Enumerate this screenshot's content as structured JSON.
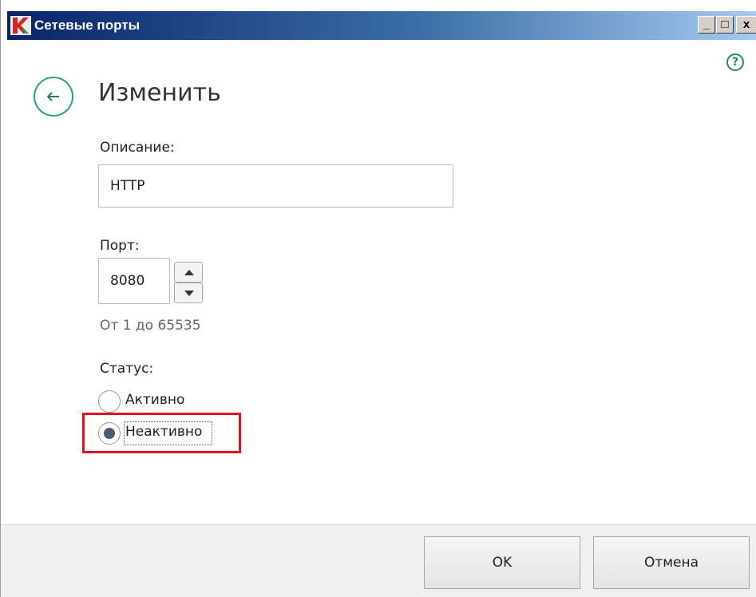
{
  "window": {
    "title": "Сетевые порты",
    "help_symbol": "?",
    "controls": {
      "minimize": "_",
      "maximize": "□",
      "close": "x"
    }
  },
  "page": {
    "title": "Изменить"
  },
  "description": {
    "label": "Описание:",
    "value": "HTTP"
  },
  "port": {
    "label": "Порт:",
    "value": "8080",
    "hint": "От 1 до 65535"
  },
  "status": {
    "label": "Статус:",
    "options": [
      {
        "label": "Активно",
        "selected": false
      },
      {
        "label": "Неактивно",
        "selected": true
      }
    ]
  },
  "footer": {
    "ok_label": "OK",
    "cancel_label": "Отмена"
  },
  "colors": {
    "accent": "#2aa07a",
    "highlight": "#e0151f",
    "titlebar_start": "#0a246a",
    "titlebar_end": "#a6caf0"
  }
}
